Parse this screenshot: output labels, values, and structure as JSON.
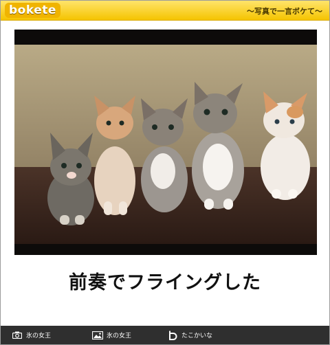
{
  "header": {
    "logo_text": "bokete",
    "tagline": "〜写真で一言ボケて〜"
  },
  "photo": {
    "alt": "five kittens sitting in a row"
  },
  "caption": "前奏でフライングした",
  "footer": {
    "items": [
      {
        "icon": "camera-icon",
        "label": "氷の女王"
      },
      {
        "icon": "image-icon",
        "label": "氷の女王"
      },
      {
        "icon": "bokete-b-icon",
        "label": "たこかいな"
      }
    ]
  },
  "colors": {
    "header_yellow": "#f5c400",
    "footer_dark": "#2f2f2f",
    "caption_text": "#111111"
  }
}
